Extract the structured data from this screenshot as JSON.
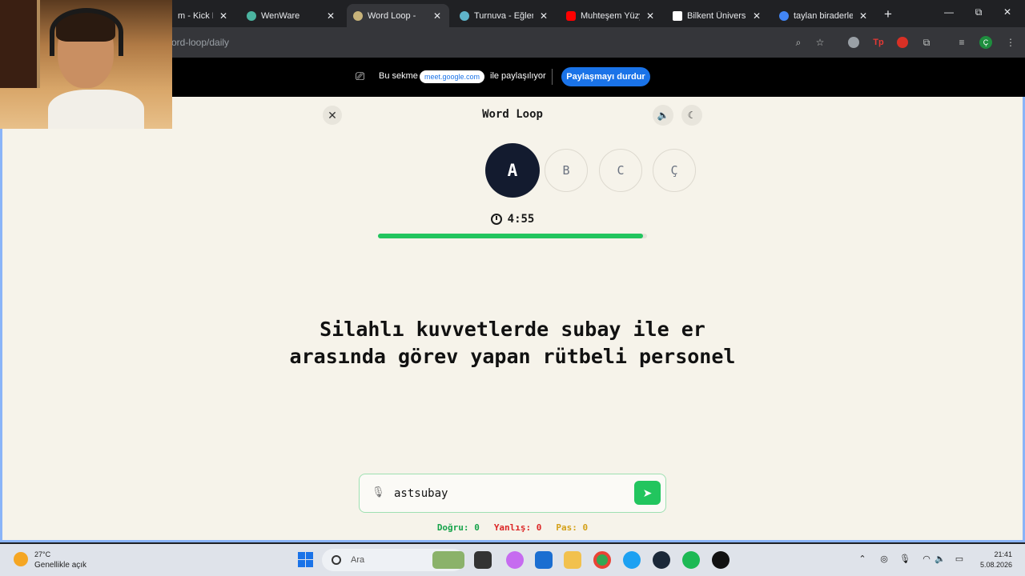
{
  "browser": {
    "tabs": [
      {
        "title": "m - Kick Da",
        "favicon_color": "#53fc18",
        "active": false
      },
      {
        "title": "WenWare",
        "favicon_color": "#4bb4a0",
        "active": false
      },
      {
        "title": "Word Loop -",
        "favicon_color": "#c7b37a",
        "active": true
      },
      {
        "title": "Turnuva - Eğlence",
        "favicon_color": "#5fb3c9",
        "active": false
      },
      {
        "title": "Muhteşem Yüzyıl",
        "favicon_color": "#ff0000",
        "active": false
      },
      {
        "title": "Bilkent Üniversit",
        "favicon_color": "#ffffff",
        "active": false
      },
      {
        "title": "taylan biraderler",
        "favicon_color": "#4285f4",
        "active": false
      }
    ],
    "tab_close_glyph": "✕",
    "new_tab_glyph": "+",
    "window_controls": {
      "minimize": "—",
      "maximize": "⧉",
      "close": "✕"
    },
    "url": "ord-loop/daily",
    "profile_initial": "Ç"
  },
  "share_bar": {
    "prefix": "Bu sekme",
    "domain": "meet.google.com",
    "suffix": "ile paylaşılıyor",
    "stop_label": "Paylaşmayı durdur"
  },
  "game": {
    "close_glyph": "✕",
    "title": "Word Loop",
    "sound_icon_glyph": "🔈",
    "theme_icon_glyph": "☾",
    "letters": [
      {
        "label": "A",
        "active": true
      },
      {
        "label": "B",
        "active": false
      },
      {
        "label": "C",
        "active": false
      },
      {
        "label": "Ç",
        "active": false
      }
    ],
    "timer": "4:55",
    "progress_fraction": 0.985,
    "accent_color": "#22c55e",
    "question": "Silahlı kuvvetlerde subay ile er arasında görev yapan rütbeli personel",
    "answer_value": "astsubay",
    "mic_glyph": "🎙",
    "send_glyph": "➤",
    "stats": {
      "correct_label": "Doğru:",
      "correct_value": "0",
      "wrong_label": "Yanlış:",
      "wrong_value": "0",
      "pass_label": "Pas:",
      "pass_value": "0"
    }
  },
  "taskbar": {
    "weather_temp": "27°C",
    "weather_desc": "Genellikle açık",
    "search_label": "Ara",
    "time": "21:41",
    "date": "5.08.2026",
    "app_icons": [
      "widgets-icon",
      "file-explorer-icon",
      "copilot-icon",
      "outlook-icon",
      "folder-icon",
      "chrome-icon",
      "edge-icon",
      "steam-icon",
      "spotify-icon",
      "github-icon"
    ]
  }
}
